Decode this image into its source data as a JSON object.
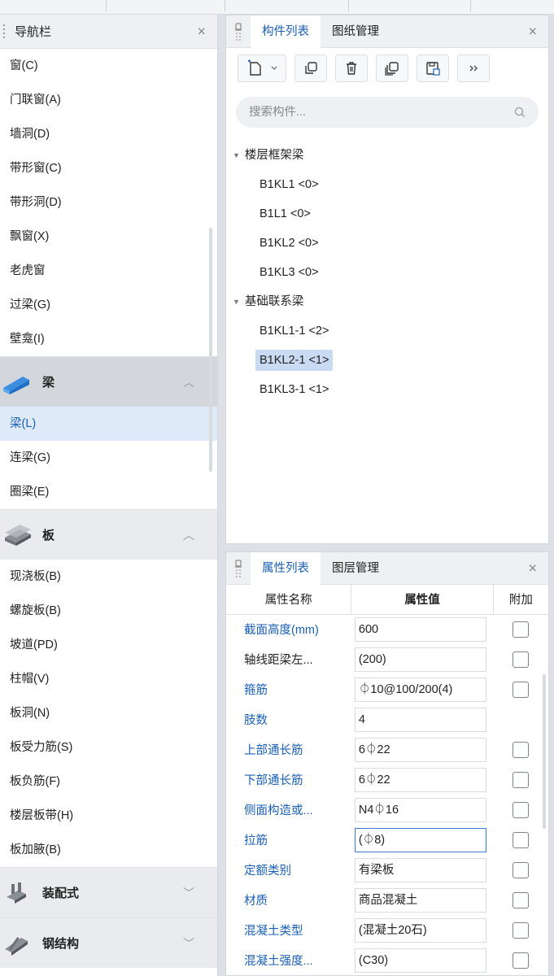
{
  "nav": {
    "title": "导航栏",
    "items_top": [
      {
        "label": "窗(C)"
      },
      {
        "label": "门联窗(A)"
      },
      {
        "label": "墙洞(D)"
      },
      {
        "label": "带形窗(C)"
      },
      {
        "label": "带形洞(D)"
      },
      {
        "label": "飘窗(X)"
      },
      {
        "label": "老虎窗"
      },
      {
        "label": "过梁(G)"
      },
      {
        "label": "壁龛(I)"
      }
    ],
    "cat_beam": "梁",
    "beam_items": [
      {
        "label": "梁(L)"
      },
      {
        "label": "连梁(G)"
      },
      {
        "label": "圈梁(E)"
      }
    ],
    "cat_slab": "板",
    "slab_items": [
      {
        "label": "现浇板(B)"
      },
      {
        "label": "螺旋板(B)"
      },
      {
        "label": "坡道(PD)"
      },
      {
        "label": "柱帽(V)"
      },
      {
        "label": "板洞(N)"
      },
      {
        "label": "板受力筋(S)"
      },
      {
        "label": "板负筋(F)"
      },
      {
        "label": "楼层板带(H)"
      },
      {
        "label": "板加腋(B)"
      }
    ],
    "cat_prefab": "装配式",
    "cat_steel": "钢结构"
  },
  "components": {
    "tab_active": "构件列表",
    "tab_other": "图纸管理",
    "search_placeholder": "搜索构件...",
    "groups": [
      {
        "label": "楼层框架梁",
        "items": [
          "B1KL1 <0>",
          "B1L1 <0>",
          "B1KL2 <0>",
          "B1KL3 <0>"
        ]
      },
      {
        "label": "基础联系梁",
        "items": [
          "B1KL1-1 <2>",
          "B1KL2-1 <1>",
          "B1KL3-1 <1>"
        ]
      }
    ]
  },
  "properties": {
    "tab_active": "属性列表",
    "tab_other": "图层管理",
    "col_name": "属性名称",
    "col_value": "属性值",
    "col_extra": "附加",
    "rows": [
      {
        "name": "截面高度(mm)",
        "value": "600"
      },
      {
        "name": "轴线距梁左...",
        "value": "(200)"
      },
      {
        "name": "箍筋",
        "value": "⏀10@100/200(4)"
      },
      {
        "name": "肢数",
        "value": "4"
      },
      {
        "name": "上部通长筋",
        "value": "6⏀22"
      },
      {
        "name": "下部通长筋",
        "value": "6⏀22"
      },
      {
        "name": "侧面构造或...",
        "value": "N4⏀16"
      },
      {
        "name": "拉筋",
        "value": "(⏀8)"
      },
      {
        "name": "定额类别",
        "value": "有梁板"
      },
      {
        "name": "材质",
        "value": "商品混凝土"
      },
      {
        "name": "混凝土类型",
        "value": "(混凝土20石)"
      },
      {
        "name": "混凝土强度...",
        "value": "(C30)"
      }
    ]
  }
}
